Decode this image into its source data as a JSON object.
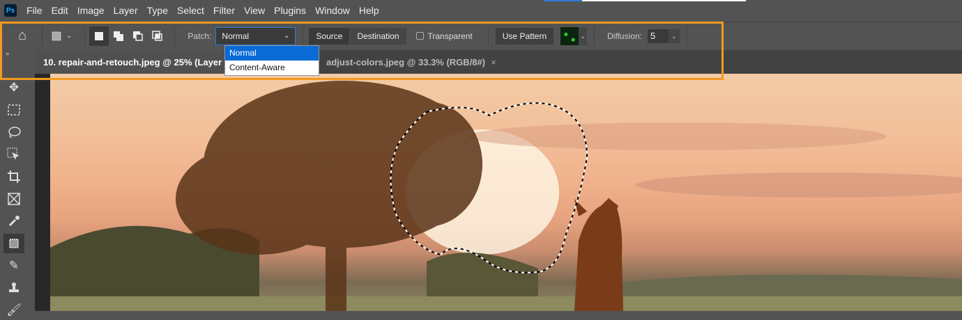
{
  "menu": {
    "items": [
      "File",
      "Edit",
      "Image",
      "Layer",
      "Type",
      "Select",
      "Filter",
      "View",
      "Plugins",
      "Window",
      "Help"
    ],
    "logo": "Ps"
  },
  "options": {
    "patch_label": "Patch:",
    "patch_value": "Normal",
    "patch_options": [
      "Normal",
      "Content-Aware"
    ],
    "source": "Source",
    "destination": "Destination",
    "transparent": "Transparent",
    "use_pattern": "Use Pattern",
    "diffusion_label": "Diffusion:",
    "diffusion_value": "5"
  },
  "tabs": [
    {
      "label": "10. repair-and-retouch.jpeg @ 25% (Layer"
    },
    {
      "label": "adjust-colors.jpeg @ 33.3% (RGB/8#)",
      "close": "×"
    }
  ],
  "colors": {
    "highlight": "#f39a1e",
    "accent": "#0a6ad6"
  }
}
